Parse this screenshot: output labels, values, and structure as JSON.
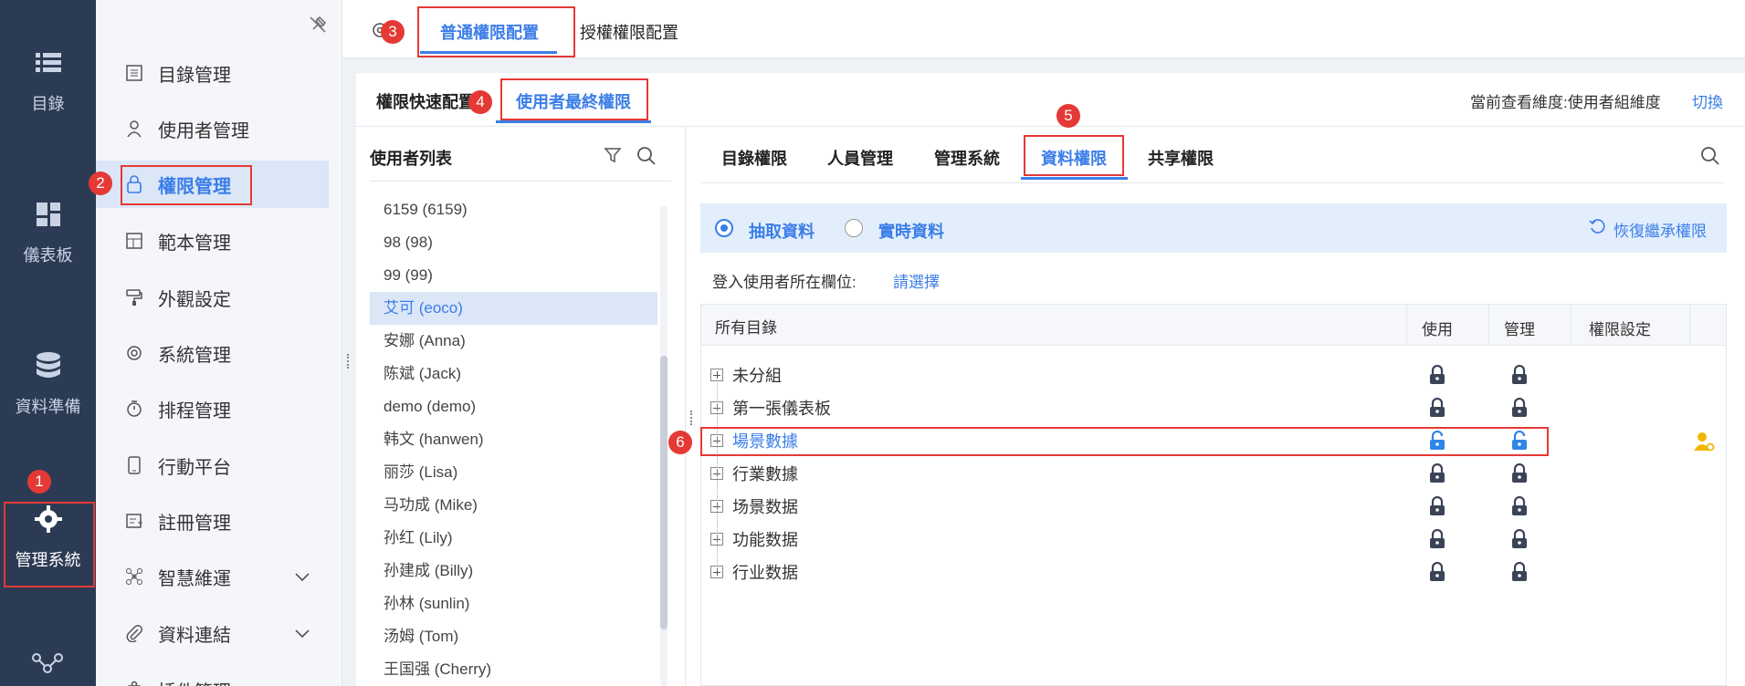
{
  "rail": {
    "items": [
      {
        "label": "目錄",
        "icon": "list-icon"
      },
      {
        "label": "儀表板",
        "icon": "dashboard-icon"
      },
      {
        "label": "資料準備",
        "icon": "database-icon"
      },
      {
        "label": "管理系統",
        "icon": "gear-icon"
      }
    ]
  },
  "sidebar": {
    "items": [
      {
        "label": "目錄管理"
      },
      {
        "label": "使用者管理"
      },
      {
        "label": "權限管理"
      },
      {
        "label": "範本管理"
      },
      {
        "label": "外觀設定"
      },
      {
        "label": "系統管理"
      },
      {
        "label": "排程管理"
      },
      {
        "label": "行動平台"
      },
      {
        "label": "註冊管理"
      },
      {
        "label": "智慧維運"
      },
      {
        "label": "資料連結"
      },
      {
        "label": "插件管理"
      }
    ]
  },
  "header": {
    "tabs": [
      {
        "label": "普通權限配置"
      },
      {
        "label": "授權權限配置"
      }
    ]
  },
  "subtabs": [
    {
      "label": "權限快速配置"
    },
    {
      "label": "使用者最終權限"
    }
  ],
  "dimension": {
    "text": "當前查看維度:使用者組維度",
    "switch": "切換"
  },
  "userlist": {
    "title": "使用者列表",
    "users": [
      "6159 (6159)",
      "98 (98)",
      "99 (99)",
      "艾可 (eoco)",
      "安娜 (Anna)",
      "陈斌 (Jack)",
      "demo (demo)",
      "韩文 (hanwen)",
      "丽莎 (Lisa)",
      "马功成 (Mike)",
      "孙红 (Lily)",
      "孙建成 (Billy)",
      "孙林 (sunlin)",
      "汤姆 (Tom)",
      "王国强 (Cherry)"
    ]
  },
  "permtabs": [
    {
      "label": "目錄權限"
    },
    {
      "label": "人員管理"
    },
    {
      "label": "管理系統"
    },
    {
      "label": "資料權限"
    },
    {
      "label": "共享權限"
    }
  ],
  "radios": {
    "extract": "抽取資料",
    "realtime": "實時資料",
    "restore": "恢復繼承權限"
  },
  "login_field": {
    "label": "登入使用者所在欄位:",
    "select": "請選擇"
  },
  "table": {
    "headers": [
      "所有目錄",
      "使用",
      "管理",
      "權限設定"
    ],
    "rows": [
      "未分組",
      "第一張儀表板",
      "場景數據",
      "行業數據",
      "场景数据",
      "功能数据",
      "行业数据"
    ]
  },
  "badges": [
    "1",
    "2",
    "3",
    "4",
    "5",
    "6"
  ],
  "colors": {
    "accent": "#3b7ee8",
    "highlight": "#e53935",
    "rail": "#2c3b54"
  }
}
